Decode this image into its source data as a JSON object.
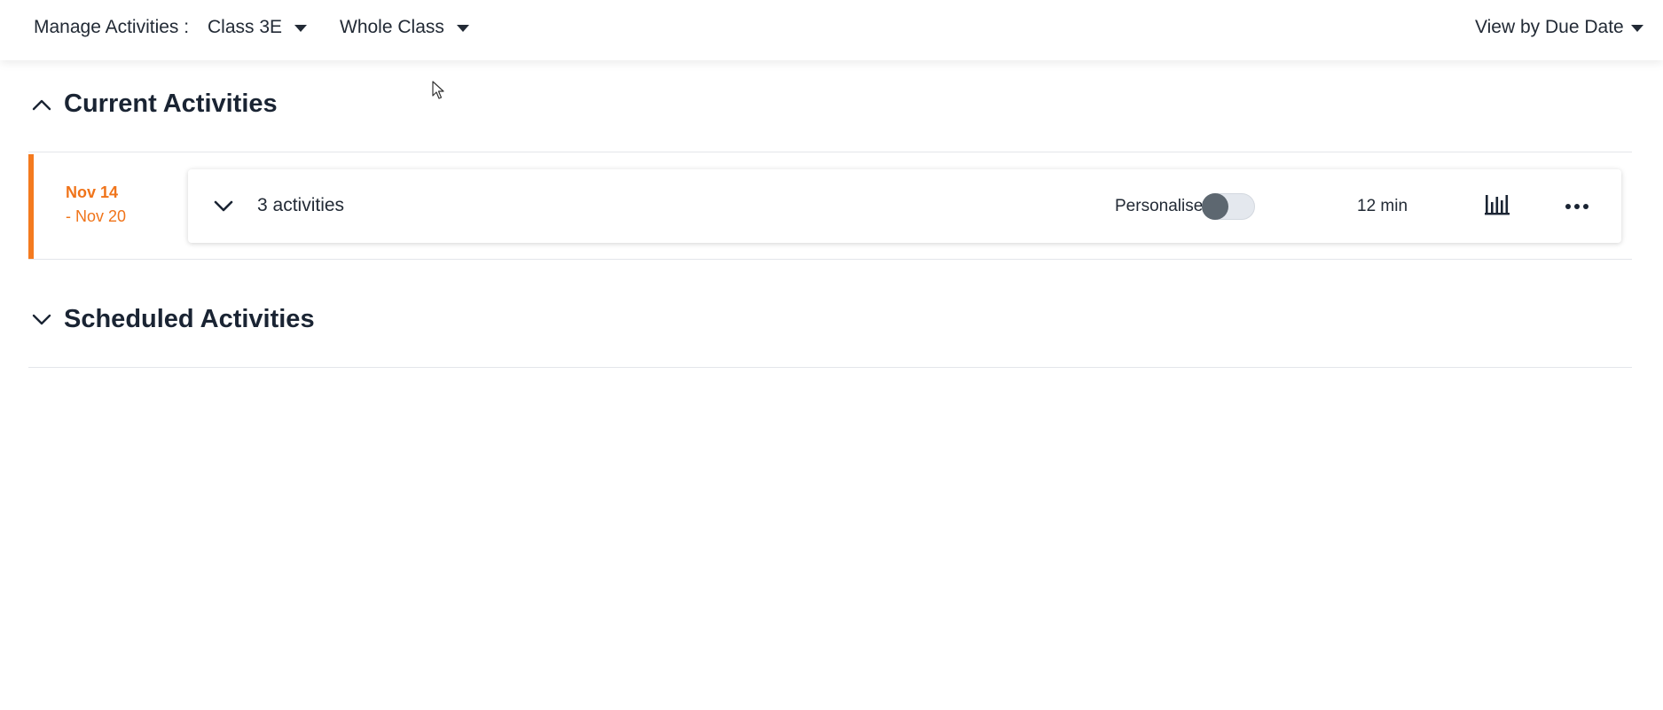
{
  "header": {
    "manage_label": "Manage Activities :",
    "class_select": "Class 3E",
    "group_select": "Whole Class",
    "view_select": "View by Due Date"
  },
  "current_section": {
    "title": "Current Activities",
    "expanded": true,
    "groups": [
      {
        "date_start": "Nov 14",
        "date_end": "- Nov 20",
        "count_label": "3 activities",
        "personalise_label": "Personalise",
        "personalise_on": false,
        "duration": "12 min"
      }
    ]
  },
  "scheduled_section": {
    "title": "Scheduled Activities",
    "expanded": false
  },
  "colors": {
    "accent": "#f47a1f",
    "text": "#1a2433",
    "toggle_knob": "#5d6770",
    "toggle_track": "#e4e8ee"
  },
  "icons": {
    "collapse": "chevron-up-icon",
    "expand": "chevron-down-icon",
    "caret": "caret-down-icon",
    "stats": "bar-chart-icon",
    "more": "more-horizontal-icon"
  }
}
